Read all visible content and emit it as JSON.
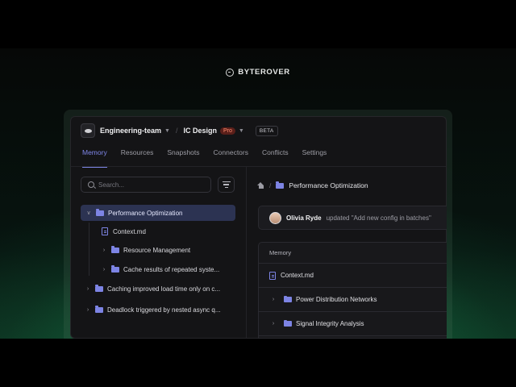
{
  "brand": {
    "name": "BYTEROVER"
  },
  "topbar": {
    "workspace": "Engineering-team",
    "project": "IC Design",
    "plan_badge": "Pro",
    "beta_badge": "BETA"
  },
  "tabs": [
    {
      "label": "Memory",
      "active": true
    },
    {
      "label": "Resources",
      "active": false
    },
    {
      "label": "Snapshots",
      "active": false
    },
    {
      "label": "Connectors",
      "active": false
    },
    {
      "label": "Conflicts",
      "active": false
    },
    {
      "label": "Settings",
      "active": false
    }
  ],
  "search": {
    "placeholder": "Search..."
  },
  "tree": [
    {
      "label": "Performance Optimization",
      "type": "folder",
      "expanded": true,
      "selected": true
    },
    {
      "label": "Context.md",
      "type": "file"
    },
    {
      "label": "Resource Management",
      "type": "folder"
    },
    {
      "label": "Cache results of repeated syste...",
      "type": "folder"
    },
    {
      "label": "Caching improved load time only on c...",
      "type": "folder"
    },
    {
      "label": "Deadlock triggered by nested async q...",
      "type": "folder"
    }
  ],
  "breadcrumb": {
    "current": "Performance Optimization"
  },
  "activity": {
    "user": "Olivia Ryde",
    "text": "updated \"Add new config in batches\""
  },
  "memory_table": {
    "header": "Memory",
    "rows": [
      {
        "label": "Context.md",
        "type": "file"
      },
      {
        "label": "Power Distribution Networks",
        "type": "folder"
      },
      {
        "label": "Signal Integrity Analysis",
        "type": "folder"
      }
    ]
  },
  "colors": {
    "accent": "#7f86e8",
    "selected_bg": "#2c3352",
    "pro_badge": "#ff8c6e",
    "glow": "#28c878"
  }
}
